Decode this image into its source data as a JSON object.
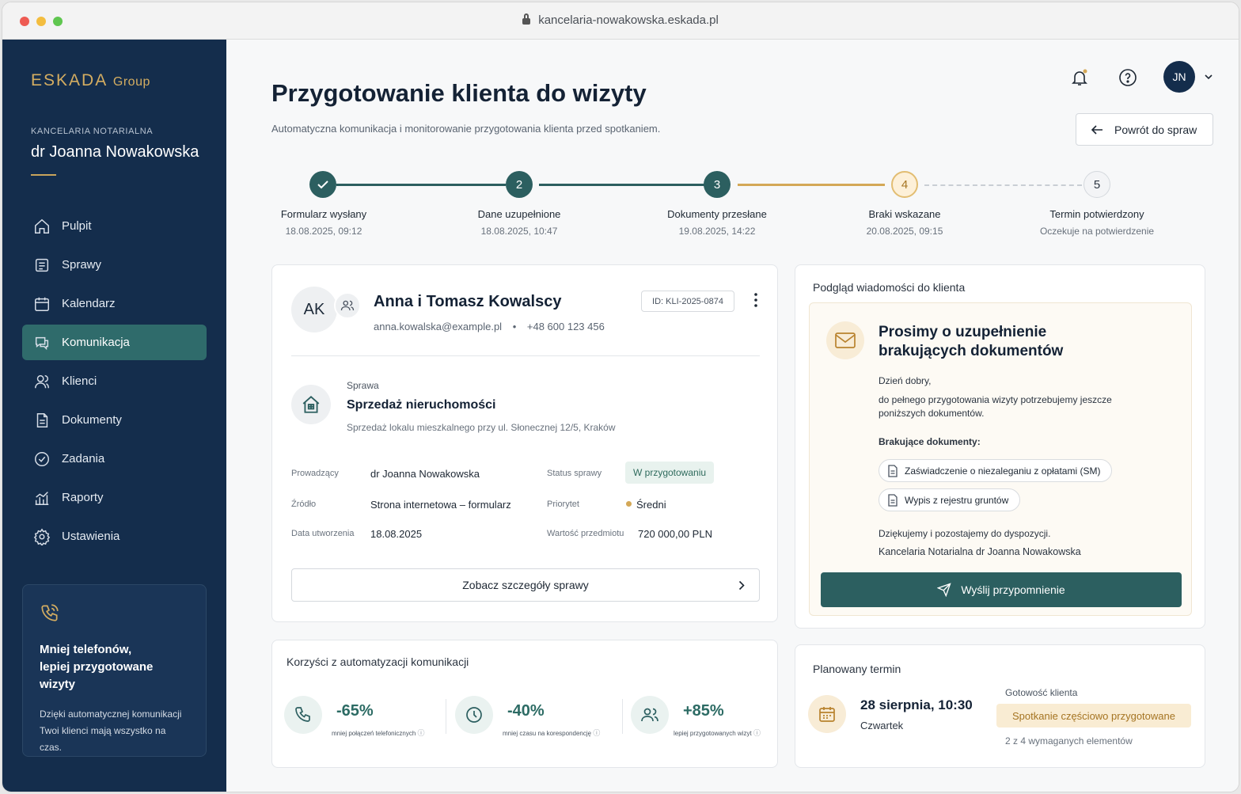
{
  "browser": {
    "url": "kancelaria-nowakowska.eskada.pl"
  },
  "sidebar": {
    "brand_main": "ESKADA",
    "brand_sub": "Group",
    "office_label": "KANCELARIA NOTARIALNA",
    "office_name": "dr Joanna Nowakowska",
    "items": [
      {
        "label": "Pulpit",
        "icon": "home-icon"
      },
      {
        "label": "Sprawy",
        "icon": "cases-icon"
      },
      {
        "label": "Kalendarz",
        "icon": "calendar-icon"
      },
      {
        "label": "Komunikacja",
        "icon": "chat-icon",
        "active": true
      },
      {
        "label": "Klienci",
        "icon": "users-icon"
      },
      {
        "label": "Dokumenty",
        "icon": "document-icon"
      },
      {
        "label": "Zadania",
        "icon": "check-circle-icon"
      },
      {
        "label": "Raporty",
        "icon": "chart-icon"
      },
      {
        "label": "Ustawienia",
        "icon": "gear-icon"
      }
    ],
    "promo": {
      "title": "Mniej telefonów,\nlepiej przygotowane wizyty",
      "text": "Dzięki automatycznej komunikacji Twoi klienci mają wszystko na czas."
    }
  },
  "header": {
    "title": "Przygotowanie klienta do wizyty",
    "subtitle": "Automatyczna komunikacja i monitorowanie przygotowania klienta przed spotkaniem.",
    "back_label": "Powrót do spraw",
    "user_initials": "JN"
  },
  "steps": [
    {
      "number": "✓",
      "label": "Formularz wysłany",
      "date": "18.08.2025, 09:12",
      "state": "done"
    },
    {
      "number": "2",
      "label": "Dane uzupełnione",
      "date": "18.08.2025, 10:47",
      "state": "done"
    },
    {
      "number": "3",
      "label": "Dokumenty przesłane",
      "date": "19.08.2025, 14:22",
      "state": "done"
    },
    {
      "number": "4",
      "label": "Braki wskazane",
      "date": "20.08.2025, 09:15",
      "state": "current"
    },
    {
      "number": "5",
      "label": "Termin potwierdzony",
      "date": "Oczekuje na potwierdzenie",
      "state": "pending"
    }
  ],
  "client": {
    "initials": "AK",
    "name": "Anna i Tomasz Kowalscy",
    "email": "anna.kowalska@example.pl",
    "phone": "+48 600 123 456",
    "id": "ID: KLI-2025-0874",
    "case_label": "Sprawa",
    "case_title": "Sprzedaż nieruchomości",
    "case_desc": "Sprzedaż lokalu mieszkalnego przy ul. Słonecznej 12/5, Kraków",
    "fields": {
      "lead_label": "Prowadzący",
      "lead_value": "dr Joanna Nowakowska",
      "status_label": "Status sprawy",
      "status_value": "W przygotowaniu",
      "source_label": "Źródło",
      "source_value": "Strona internetowa – formularz",
      "priority_label": "Priorytet",
      "priority_value": "Średni",
      "created_label": "Data utworzenia",
      "created_value": "18.08.2025",
      "value_label": "Wartość przedmiotu",
      "value_value": "720 000,00 PLN"
    },
    "details_label": "Zobacz szczegóły sprawy"
  },
  "benefits": {
    "title": "Korzyści z automatyzacji komunikacji",
    "metrics": [
      {
        "value": "-65%",
        "label": "mniej połączeń telefonicznych",
        "icon": "phone-icon"
      },
      {
        "value": "-40%",
        "label": "mniej czasu na korespondencję",
        "icon": "clock-icon"
      },
      {
        "value": "+85%",
        "label": "lepiej przygotowanych wizyt",
        "icon": "users-icon"
      }
    ]
  },
  "message": {
    "header": "Podgląd wiadomości do klienta",
    "title": "Prosimy o uzupełnienie brakujących dokumentów",
    "greeting": "Dzień dobry,",
    "body": "do pełnego przygotowania wizyty potrzebujemy jeszcze poniższych dokumentów.",
    "missing_label": "Brakujące dokumenty:",
    "documents": [
      "Zaświadczenie o niezaleganiu z opłatami (SM)",
      "Wypis z rejestru gruntów"
    ],
    "thanks": "Dziękujemy i pozostajemy do dyspozycji.",
    "signature": "Kancelaria Notarialna dr Joanna Nowakowska",
    "send_label": "Wyślij przypomnienie"
  },
  "term": {
    "title": "Planowany termin",
    "date": "28 sierpnia, 10:30",
    "day": "Czwartek",
    "readiness_label": "Gotowość klienta",
    "readiness_status": "Spotkanie częściowo przygotowane",
    "readiness_count": "2 z 4 wymaganych elementów"
  },
  "colors": {
    "sidebar": "#142d4c",
    "accent_teal": "#2c5f60",
    "accent_gold": "#d4a857"
  }
}
